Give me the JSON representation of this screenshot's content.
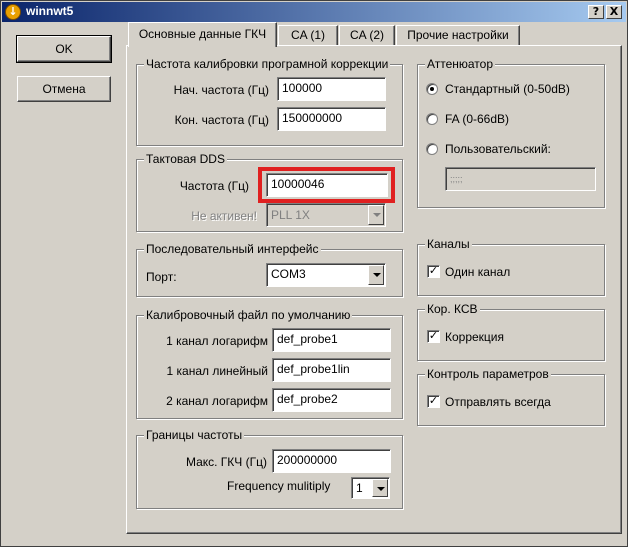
{
  "window": {
    "title": "winnwt5",
    "help_label": "?",
    "close_label": "X"
  },
  "buttons": {
    "ok": "OK",
    "cancel": "Отмена"
  },
  "tabs": [
    {
      "label": "Основные данные ГКЧ",
      "active": true
    },
    {
      "label": "CA (1)",
      "active": false
    },
    {
      "label": "CA (2)",
      "active": false
    },
    {
      "label": "Прочие настройки",
      "active": false
    }
  ],
  "calibration": {
    "title": "Частота калибровки програмной коррекции",
    "start_label": "Нач. частота (Гц)",
    "start_value": "100000",
    "end_label": "Кон. частота (Гц)",
    "end_value": "150000000"
  },
  "dds": {
    "title": "Тактовая DDS",
    "freq_label": "Частота (Гц)",
    "freq_value": "10000046",
    "inactive_label": "Не активен!",
    "pll_value": "PLL 1X"
  },
  "serial": {
    "title": "Последовательный интерфейс",
    "port_label": "Порт:",
    "port_value": "COM3"
  },
  "calfile": {
    "title": "Калибровочный файл по умолчанию",
    "rows": [
      {
        "label": "1 канал логарифм",
        "value": "def_probe1"
      },
      {
        "label": "1 канал линейный",
        "value": "def_probe1lin"
      },
      {
        "label": "2 канал логарифм",
        "value": "def_probe2"
      }
    ]
  },
  "limits": {
    "title": "Границы частоты",
    "max_label": "Макс. ГКЧ (Гц)",
    "max_value": "200000000",
    "mult_label": "Frequency mulitiply",
    "mult_value": "1"
  },
  "attenuator": {
    "title": "Аттенюатор",
    "options": [
      {
        "label": "Стандартный (0-50dB)",
        "selected": true
      },
      {
        "label": "FA (0-66dB)",
        "selected": false
      },
      {
        "label": "Пользовательский:",
        "selected": false
      }
    ],
    "custom_value": ";;;;;"
  },
  "channels": {
    "title": "Каналы",
    "single_label": "Один канал",
    "single_checked": true
  },
  "swr": {
    "title": "Кор. КСВ",
    "corr_label": "Коррекция",
    "corr_checked": true
  },
  "params": {
    "title": "Контроль параметров",
    "send_label": "Отправлять всегда",
    "send_checked": true
  },
  "colors": {
    "title_bar": "#0a246a",
    "face": "#d4d0c8",
    "highlight": "#e02020"
  },
  "icons": {
    "app": "app-icon",
    "dropdown": "chevron-down-icon",
    "check": "check-icon"
  }
}
